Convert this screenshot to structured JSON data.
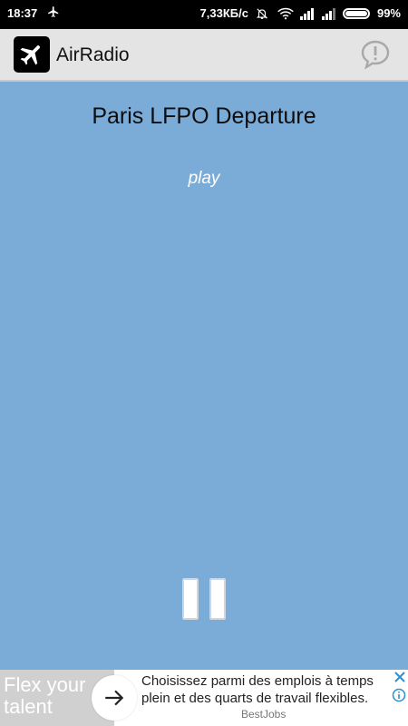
{
  "status_bar": {
    "time": "18:37",
    "network_speed": "7,33КБ/с",
    "battery": "99%"
  },
  "app_bar": {
    "title": "AirRadio",
    "logo_icon": "airplane-icon",
    "action_icon": "feedback-bubble-icon"
  },
  "player": {
    "station": "Paris LFPO Departure",
    "status": "play",
    "control_icon": "pause-icon"
  },
  "ad": {
    "headline": "Flex your talent",
    "body": "Choisissez parmi des emplois à temps plein et des quarts de travail flexibles.",
    "brand": "BestJobs"
  },
  "colors": {
    "background": "#7bacd8",
    "app_bar": "#e4e4e4",
    "status_bar": "#000000"
  }
}
